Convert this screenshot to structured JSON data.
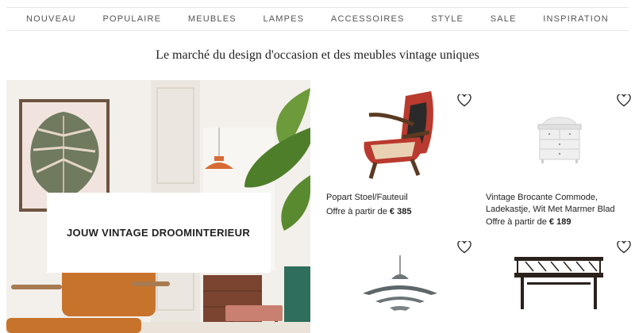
{
  "nav": {
    "items": [
      {
        "label": "NOUVEAU"
      },
      {
        "label": "POPULAIRE"
      },
      {
        "label": "MEUBLES"
      },
      {
        "label": "LAMPES"
      },
      {
        "label": "ACCESSOIRES"
      },
      {
        "label": "STYLE"
      },
      {
        "label": "SALE"
      },
      {
        "label": "INSPIRATION"
      }
    ]
  },
  "tagline": "Le marché du design d'occasion et des meubles vintage uniques",
  "hero": {
    "cta_label": "JOUW VINTAGE DROOMINTERIEUR"
  },
  "products": [
    {
      "name": "Popart Stoel/Fauteuil",
      "price_prefix": "Offre à partir de",
      "price": "€ 385",
      "image_icon": "armchair-image"
    },
    {
      "name": "Vintage Brocante Commode, Ladekastje, Wit Met Marmer Blad",
      "price_prefix": "Offre à partir de",
      "price": "€ 189",
      "image_icon": "commode-image"
    },
    {
      "name": "",
      "price_prefix": "",
      "price": "",
      "image_icon": "pendant-lamp-image"
    },
    {
      "name": "",
      "price_prefix": "",
      "price": "",
      "image_icon": "bench-table-image"
    }
  ],
  "colors": {
    "accent_orange": "#c8732c",
    "text": "#222222",
    "nav_text": "#555555"
  }
}
